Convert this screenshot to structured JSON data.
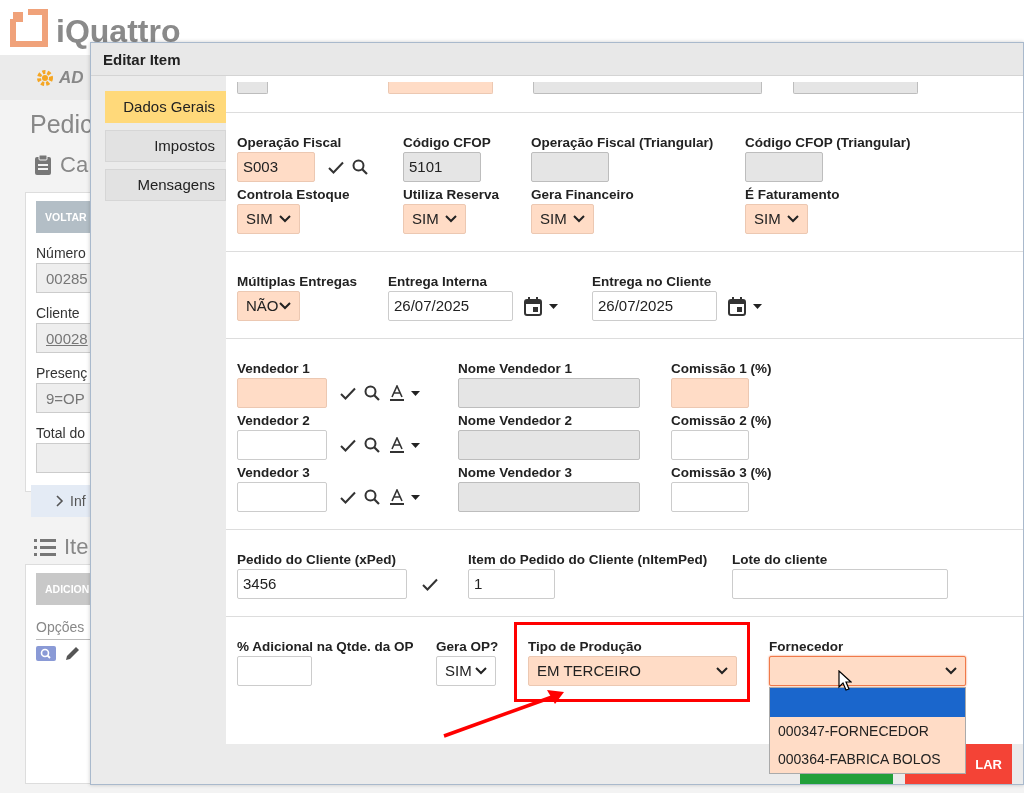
{
  "background_page": {
    "logo": "iQuattro",
    "brand": "AD",
    "page_title": "Pedic",
    "section_title": "Ca",
    "back_button": "VOLTAR",
    "fields": [
      {
        "label": "Número",
        "value": "00285",
        "kind": "field"
      },
      {
        "label": "Cliente",
        "value": "00028",
        "kind": "link"
      },
      {
        "label": "Presenç",
        "value": "9=OP",
        "kind": "field"
      },
      {
        "label": "Total do",
        "kind": "field"
      }
    ],
    "info_toggle": "Inf",
    "items_title": "Ite",
    "add_button": "ADICION",
    "options_header": "Opções"
  },
  "dialog": {
    "title": "Editar Item",
    "tabs": [
      {
        "label": "Dados Gerais",
        "selected": true
      },
      {
        "label": "Impostos",
        "selected": false
      },
      {
        "label": "Mensagens",
        "selected": false
      }
    ],
    "partial_fields": [
      {
        "required": false,
        "readonly": true
      },
      {
        "required": true,
        "readonly": false
      },
      {
        "required": false,
        "readonly": true
      },
      {
        "required": false,
        "readonly": true
      }
    ],
    "sections": [
      {
        "rows": [
          {
            "fields": [
              {
                "label": "Operação Fiscal",
                "kind": "lookup",
                "required": true,
                "readonly": false,
                "value": "S003"
              },
              {
                "label": "Código CFOP",
                "kind": "text",
                "required": false,
                "readonly": true,
                "value": "5101"
              },
              {
                "label": "Operação Fiscal (Triangular)",
                "kind": "text",
                "required": false,
                "readonly": true
              },
              {
                "label": "Código CFOP (Triangular)",
                "kind": "text",
                "required": false,
                "readonly": true
              }
            ]
          },
          {
            "fields": [
              {
                "label": "Controla Estoque",
                "kind": "select",
                "required": true,
                "readonly": false,
                "value": "SIM"
              },
              {
                "label": "Utiliza Reserva",
                "kind": "select",
                "required": true,
                "readonly": false,
                "value": "SIM"
              },
              {
                "label": "Gera Financeiro",
                "kind": "select",
                "required": true,
                "readonly": false,
                "value": "SIM"
              },
              {
                "label": "É Faturamento",
                "kind": "select",
                "required": true,
                "readonly": false,
                "value": "SIM"
              }
            ]
          }
        ]
      },
      {
        "rows": [
          {
            "fields": [
              {
                "label": "Múltiplas Entregas",
                "kind": "select",
                "required": true,
                "readonly": false,
                "value": "NÃO"
              },
              {
                "label": "Entrega Interna",
                "kind": "date",
                "required": false,
                "readonly": false,
                "value": "26/07/2025"
              },
              {
                "label": "Entrega no Cliente",
                "kind": "date",
                "required": false,
                "readonly": false,
                "value": "26/07/2025"
              }
            ]
          }
        ]
      },
      {
        "rows": [
          {
            "fields": [
              {
                "label": "Vendedor 1",
                "kind": "seller",
                "required": true,
                "readonly": false
              },
              {
                "label": "Nome Vendedor 1",
                "kind": "text",
                "required": false,
                "readonly": true
              },
              {
                "label": "Comissão 1 (%)",
                "kind": "text",
                "required": true,
                "readonly": false
              }
            ]
          },
          {
            "fields": [
              {
                "label": "Vendedor 2",
                "kind": "seller",
                "required": false,
                "readonly": false
              },
              {
                "label": "Nome Vendedor 2",
                "kind": "text",
                "required": false,
                "readonly": true
              },
              {
                "label": "Comissão 2 (%)",
                "kind": "text",
                "required": false,
                "readonly": false
              }
            ]
          },
          {
            "fields": [
              {
                "label": "Vendedor 3",
                "kind": "seller",
                "required": false,
                "readonly": false
              },
              {
                "label": "Nome Vendedor 3",
                "kind": "text",
                "required": false,
                "readonly": true
              },
              {
                "label": "Comissão 3 (%)",
                "kind": "text",
                "required": false,
                "readonly": false
              }
            ]
          }
        ]
      },
      {
        "rows": [
          {
            "fields": [
              {
                "label": "Pedido do Cliente (xPed)",
                "kind": "confirm",
                "required": false,
                "readonly": false,
                "value": "3456"
              },
              {
                "label": "Item do Pedido do Cliente (nItemPed)",
                "kind": "text",
                "required": false,
                "readonly": false,
                "value": "1"
              },
              {
                "label": "Lote do cliente",
                "kind": "text",
                "required": false,
                "readonly": false
              }
            ]
          }
        ]
      },
      {
        "rows": [
          {
            "fields": [
              {
                "label": "% Adicional na Qtde. da OP",
                "kind": "text",
                "required": false,
                "readonly": false
              },
              {
                "label": "Gera OP?",
                "kind": "select",
                "required": false,
                "readonly": false,
                "value": "SIM"
              },
              {
                "label": "Tipo de Produção",
                "kind": "select",
                "required": true,
                "readonly": false,
                "value": "EM TERCEIRO"
              },
              {
                "label": "Fornecedor",
                "kind": "select",
                "required": true,
                "readonly": false,
                "options": [
                  {
                    "selected": true
                  },
                  {
                    "label": "000347-FORNECEDOR",
                    "selected": false
                  },
                  {
                    "label": "000364-FABRICA BOLOS",
                    "selected": false
                  }
                ]
              }
            ]
          }
        ]
      }
    ],
    "footer": {
      "cancel_button": "LAR"
    }
  }
}
